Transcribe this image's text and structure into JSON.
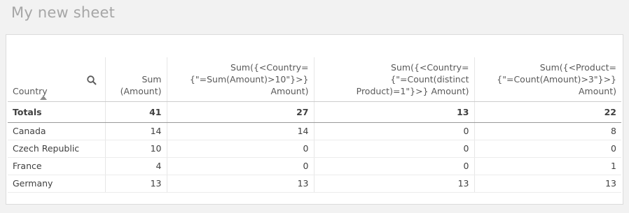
{
  "sheet": {
    "title": "My new sheet"
  },
  "table": {
    "dimension_header": "Country",
    "measure_headers": [
      "Sum (Amount)",
      "Sum({<Country={\"=Sum(Amount)>10\"}>} Amount)",
      "Sum({<Country={\"=Count(distinct Product)=1\"}>} Amount)",
      "Sum({<Product={\"=Count(Amount)>3\"}>} Amount)"
    ],
    "totals": {
      "label": "Totals",
      "values": [
        "41",
        "27",
        "13",
        "22"
      ]
    },
    "rows": [
      {
        "country": "Canada",
        "values": [
          "14",
          "14",
          "0",
          "8"
        ]
      },
      {
        "country": "Czech Republic",
        "values": [
          "10",
          "0",
          "0",
          "0"
        ]
      },
      {
        "country": "France",
        "values": [
          "4",
          "0",
          "0",
          "1"
        ]
      },
      {
        "country": "Germany",
        "values": [
          "13",
          "13",
          "13",
          "13"
        ]
      }
    ]
  },
  "icons": {
    "search": "search-icon",
    "sort": "sort-ascending-icon"
  },
  "colors": {
    "background": "#f2f2f2",
    "panel": "#ffffff",
    "title": "#a6a6a6",
    "text": "#404040"
  }
}
